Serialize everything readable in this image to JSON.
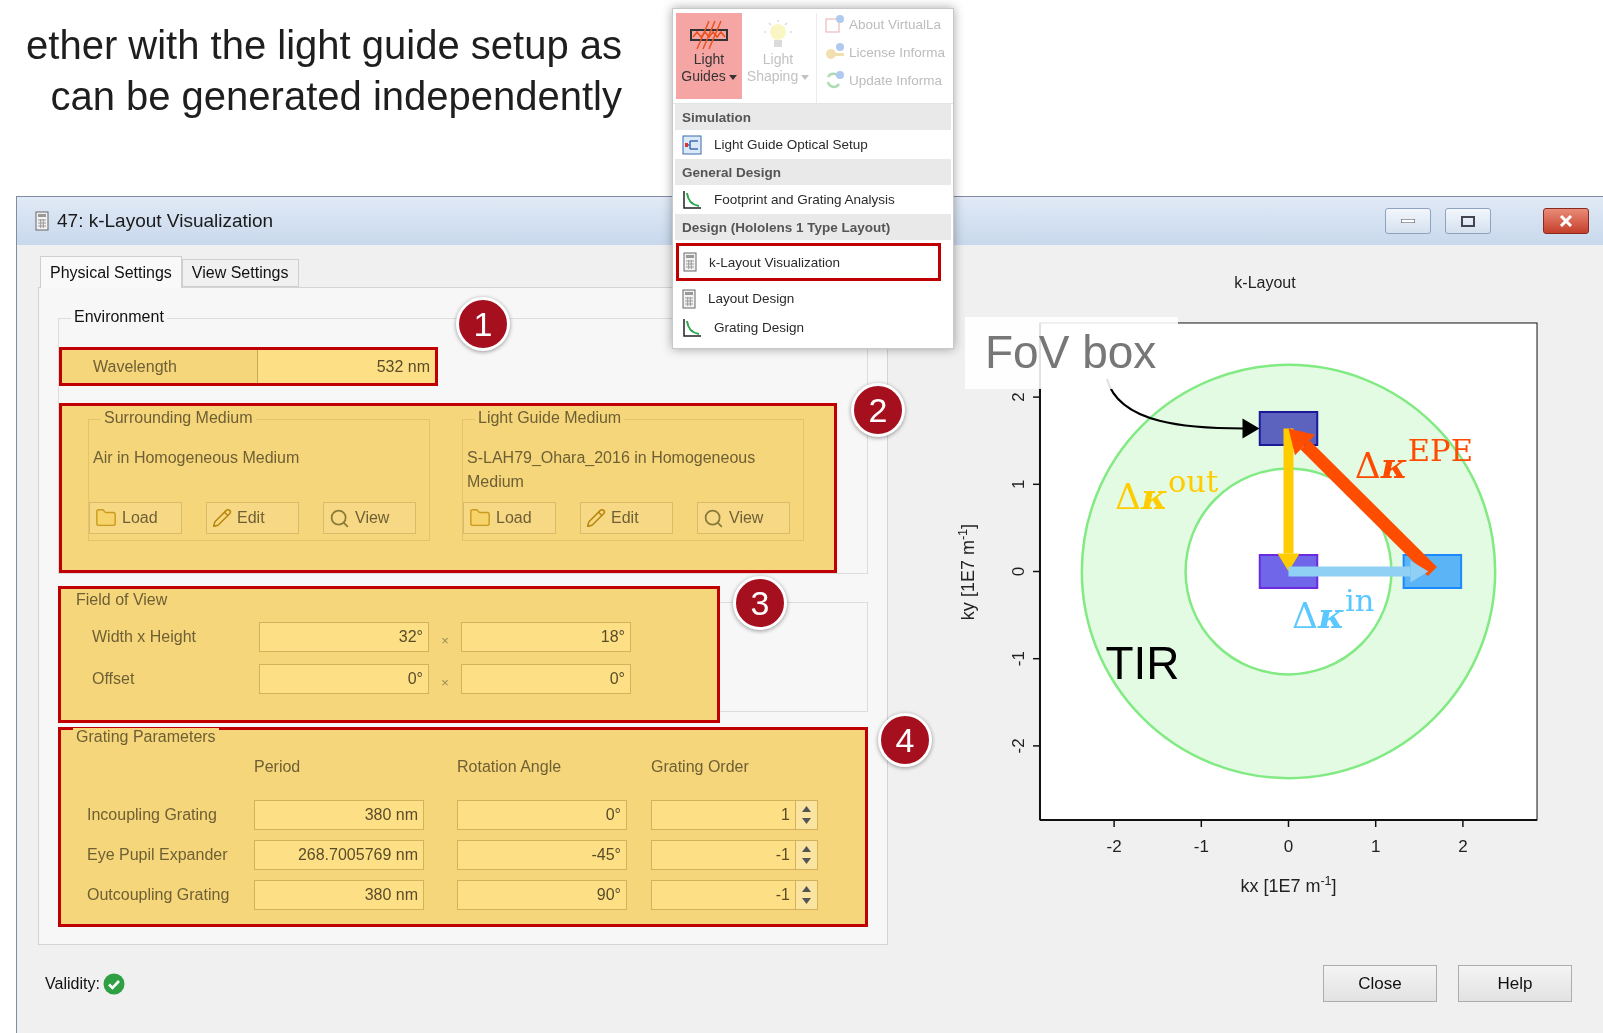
{
  "slide_caption": [
    "ether with the light guide setup as",
    "can be generated independently"
  ],
  "ribbon_menu": {
    "buttons": [
      {
        "label": "Light Guides",
        "kind": "light-guide",
        "selected": true,
        "disabled": false
      },
      {
        "label": "Light Shaping",
        "kind": "bulb",
        "selected": false,
        "disabled": true
      }
    ],
    "side_items": [
      {
        "label": "About VirtualLa",
        "kind": "info-document",
        "disabled": true
      },
      {
        "label": "License Informa",
        "kind": "key",
        "disabled": true
      },
      {
        "label": "Update Informa",
        "kind": "refresh",
        "disabled": true
      }
    ],
    "sections": [
      {
        "header": "Simulation",
        "items": [
          {
            "label": "Light Guide Optical Setup",
            "kind": "diagram",
            "highlighted": false
          }
        ]
      },
      {
        "header": "General Design",
        "items": [
          {
            "label": "Footprint and Grating Analysis",
            "kind": "chart",
            "highlighted": false
          }
        ]
      },
      {
        "header": "Design (Hololens 1 Type Layout)",
        "items": [
          {
            "label": "k-Layout Visualization",
            "kind": "calculator",
            "highlighted": true
          },
          {
            "label": "Layout Design",
            "kind": "calculator",
            "highlighted": false
          },
          {
            "label": "Grating Design",
            "kind": "chart",
            "highlighted": false
          }
        ]
      }
    ]
  },
  "window": {
    "title": "47: k-Layout Visualization",
    "tabs": [
      {
        "label": "Physical Settings",
        "selected": true
      },
      {
        "label": "View Settings",
        "selected": false
      }
    ],
    "environment": {
      "title": "Environment",
      "wavelength": {
        "label": "Wavelength",
        "value": "532 nm",
        "callout": "1"
      },
      "media_callout": "2",
      "media": [
        {
          "title": "Surrounding Medium",
          "description": "Air in Homogeneous Medium",
          "buttons": [
            {
              "label": "Load",
              "kind": "folder"
            },
            {
              "label": "Edit",
              "kind": "pencil"
            },
            {
              "label": "View",
              "kind": "magnifier"
            }
          ]
        },
        {
          "title": "Light Guide Medium",
          "description": "S-LAH79_Ohara_2016 in Homogeneous Medium",
          "buttons": [
            {
              "label": "Load",
              "kind": "folder"
            },
            {
              "label": "Edit",
              "kind": "pencil"
            },
            {
              "label": "View",
              "kind": "magnifier"
            }
          ]
        }
      ]
    },
    "field_of_view": {
      "title": "Field of View",
      "callout": "3",
      "rows": [
        {
          "label": "Width x Height",
          "values": [
            "32°",
            "18°"
          ],
          "separator": "×"
        },
        {
          "label": "Offset",
          "values": [
            "0°",
            "0°"
          ],
          "separator": "×"
        }
      ]
    },
    "grating_parameters": {
      "title": "Grating Parameters",
      "callout": "4",
      "columns": [
        "Period",
        "Rotation Angle",
        "Grating Order"
      ],
      "rows": [
        {
          "label": "Incoupling Grating",
          "period": "380 nm",
          "angle": "0°",
          "order": "1"
        },
        {
          "label": "Eye Pupil Expander",
          "period": "268.7005769 nm",
          "angle": "-45°",
          "order": "-1"
        },
        {
          "label": "Outcoupling Grating",
          "period": "380 nm",
          "angle": "90°",
          "order": "-1"
        }
      ]
    },
    "diagram": {
      "title": "k-Layout",
      "xlabel": "kx [1E7 m$^{-1}$]",
      "ylabel": "ky [1E7 m$^{-1}$]",
      "xticks": [
        "-2",
        "-1",
        "0",
        "1",
        "2"
      ],
      "yticks": [
        "-2",
        "-1",
        "0",
        "1",
        "2"
      ],
      "labels": [
        {
          "text": "FoV box",
          "kind": "callout-box",
          "color": "#777777"
        },
        {
          "text": "Δ**κ**$^{EPE}$",
          "kind": "formula",
          "color": "#ff4b00"
        },
        {
          "text": "Δ**κ**$^{out}$",
          "kind": "formula",
          "color": "#ffcc00"
        },
        {
          "text": "Δ**κ**$^{in}$",
          "kind": "formula",
          "color": "#5bc8ff"
        },
        {
          "text": "TIR",
          "kind": "label",
          "color": "#000000"
        }
      ]
    },
    "validity": {
      "label": "Validity:",
      "valid": true
    },
    "buttons": [
      "Close",
      "Help"
    ]
  }
}
